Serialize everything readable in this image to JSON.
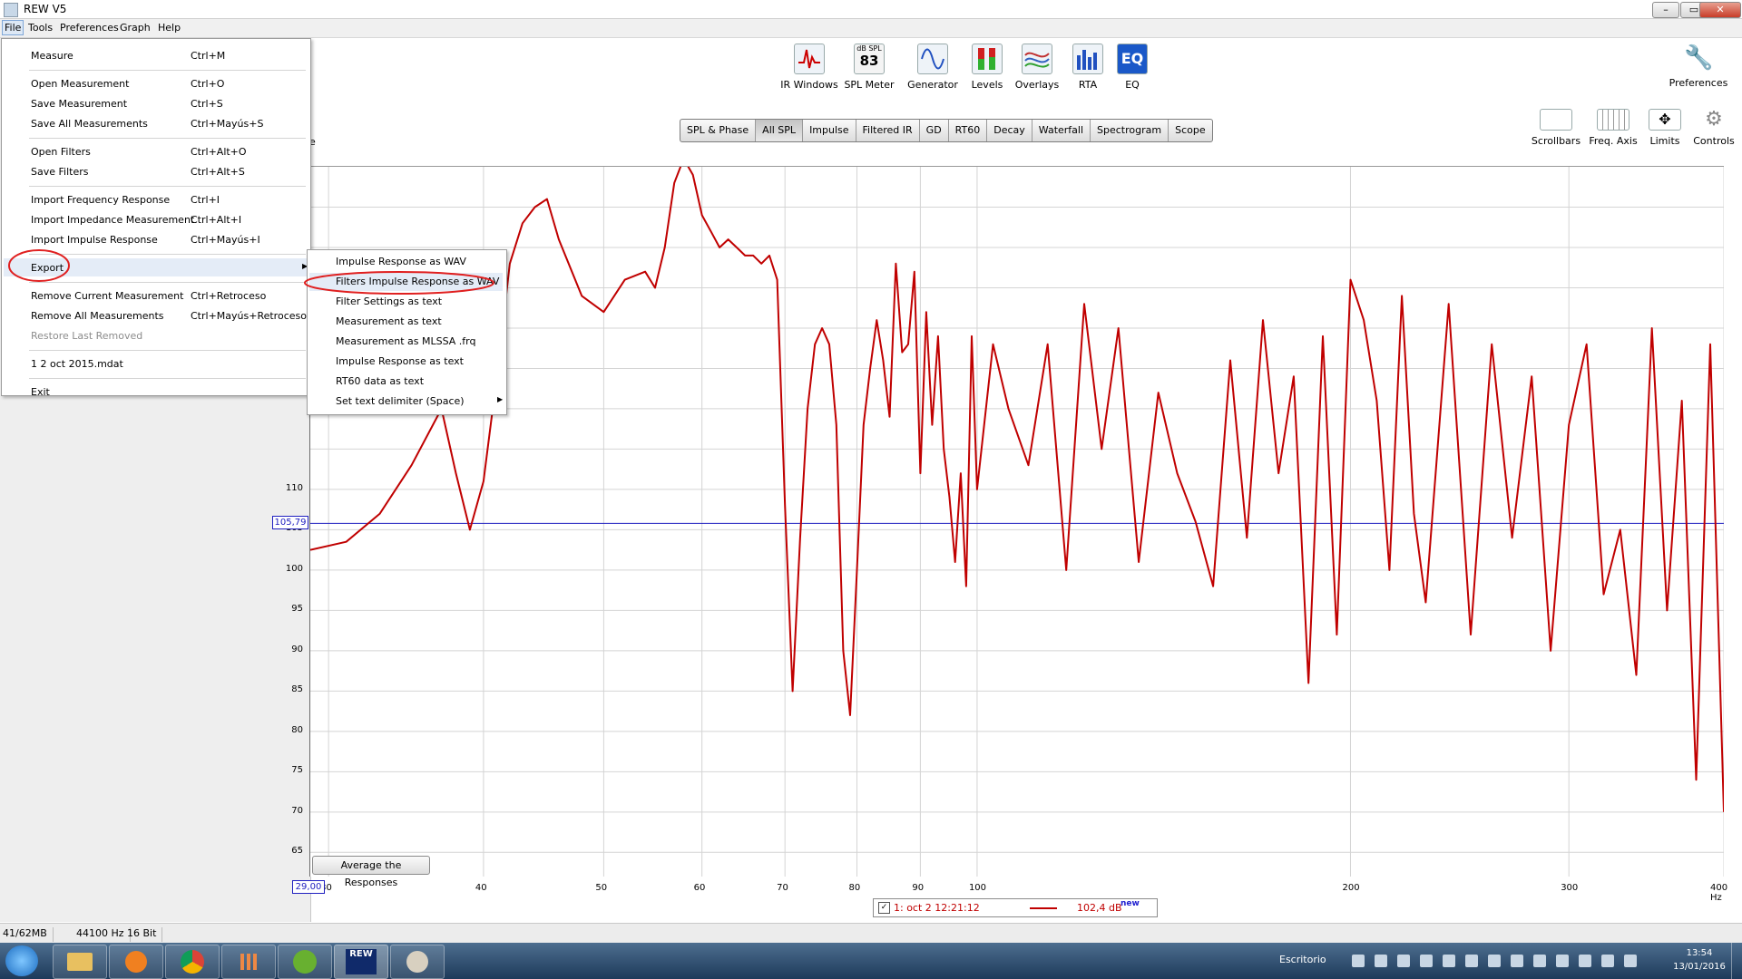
{
  "window": {
    "title": "REW V5",
    "controls": [
      "–",
      "▭",
      "✕"
    ]
  },
  "menubar": {
    "items": [
      "File",
      "Tools",
      "Preferences",
      "Graph",
      "Help"
    ]
  },
  "toolbar": {
    "items": [
      {
        "label": "IR Windows",
        "icon": "ir-windows-icon"
      },
      {
        "label": "SPL Meter",
        "icon": "spl-meter-icon",
        "top": "dB SPL",
        "value": "83"
      },
      {
        "label": "Generator",
        "icon": "generator-icon"
      },
      {
        "label": "Levels",
        "icon": "levels-icon"
      },
      {
        "label": "Overlays",
        "icon": "overlays-icon"
      },
      {
        "label": "RTA",
        "icon": "rta-icon"
      },
      {
        "label": "EQ",
        "icon": "eq-icon"
      }
    ],
    "preferences": "Preferences",
    "right_controls": [
      "Scrollbars",
      "Freq. Axis",
      "Limits",
      "Controls"
    ]
  },
  "tabs": [
    "SPL & Phase",
    "All SPL",
    "Impulse",
    "Filtered IR",
    "GD",
    "RT60",
    "Decay",
    "Waterfall",
    "Spectrogram",
    "Scope"
  ],
  "selected_tab": "All SPL",
  "file_menu": {
    "items": [
      {
        "label": "Measure",
        "shortcut": "Ctrl+M"
      },
      {
        "label": "Open Measurement",
        "shortcut": "Ctrl+O"
      },
      {
        "label": "Save Measurement",
        "shortcut": "Ctrl+S"
      },
      {
        "label": "Save All Measurements",
        "shortcut": "Ctrl+Mayús+S"
      },
      {
        "label": "Open Filters",
        "shortcut": "Ctrl+Alt+O"
      },
      {
        "label": "Save Filters",
        "shortcut": "Ctrl+Alt+S"
      },
      {
        "label": "Import Frequency Response",
        "shortcut": "Ctrl+I"
      },
      {
        "label": "Import Impedance Measurement",
        "shortcut": "Ctrl+Alt+I"
      },
      {
        "label": "Import Impulse Response",
        "shortcut": "Ctrl+Mayús+I"
      },
      {
        "label": "Export",
        "shortcut": ""
      },
      {
        "label": "Remove Current Measurement",
        "shortcut": "Ctrl+Retroceso"
      },
      {
        "label": "Remove All Measurements",
        "shortcut": "Ctrl+Mayús+Retroceso"
      },
      {
        "label": "Restore Last Removed",
        "shortcut": "",
        "disabled": true
      },
      {
        "label": "1 2 oct 2015.mdat",
        "shortcut": ""
      },
      {
        "label": "Exit",
        "shortcut": ""
      }
    ]
  },
  "export_submenu": {
    "items": [
      "Impulse Response as WAV",
      "Filters Impulse Response as WAV",
      "Filter Settings as text",
      "Measurement as text",
      "Measurement as MLSSA .frq",
      "Impulse Response as text",
      "RT60 data as text",
      "Set text delimiter (Space)"
    ]
  },
  "graph": {
    "cursor_y_value": "105,79",
    "cursor_x_value": "29,00",
    "average_button": "Average the Responses",
    "partial_label": "e",
    "legend": {
      "name": "1: oct 2 12:21:12",
      "value": "102,4 dB",
      "badge": "new",
      "color": "#c00000"
    }
  },
  "chart_data": {
    "type": "line",
    "xscale": "log",
    "xlim": [
      29,
      400
    ],
    "ylim": [
      62,
      150
    ],
    "y_ticks": [
      110,
      105,
      100,
      95,
      90,
      85,
      80,
      75,
      70,
      65
    ],
    "x_ticks": [
      {
        "v": 30,
        "label": "30"
      },
      {
        "v": 40,
        "label": "40"
      },
      {
        "v": 50,
        "label": "50"
      },
      {
        "v": 60,
        "label": "60"
      },
      {
        "v": 70,
        "label": "70"
      },
      {
        "v": 80,
        "label": "80"
      },
      {
        "v": 90,
        "label": "90"
      },
      {
        "v": 100,
        "label": "100"
      },
      {
        "v": 200,
        "label": "200"
      },
      {
        "v": 300,
        "label": "300"
      },
      {
        "v": 400,
        "label": "400 Hz"
      }
    ],
    "grid": true,
    "cursor_line": 105.79,
    "series": [
      {
        "color": "#c00000",
        "x": [
          29,
          31,
          33,
          35,
          37,
          38,
          39,
          40,
          41,
          42,
          43,
          44,
          45,
          46,
          48,
          50,
          52,
          54,
          55,
          56,
          57,
          58,
          59,
          60,
          61,
          62,
          63,
          64,
          65,
          66,
          67,
          68,
          69,
          70,
          71,
          72,
          73,
          74,
          75,
          76,
          77,
          78,
          79,
          80,
          81,
          82,
          83,
          84,
          85,
          86,
          87,
          88,
          89,
          90,
          91,
          92,
          93,
          94,
          95,
          96,
          97,
          98,
          99,
          100,
          103,
          106,
          110,
          114,
          118,
          122,
          126,
          130,
          135,
          140,
          145,
          150,
          155,
          160,
          165,
          170,
          175,
          180,
          185,
          190,
          195,
          200,
          205,
          210,
          215,
          220,
          225,
          230,
          240,
          250,
          260,
          270,
          280,
          290,
          300,
          310,
          320,
          330,
          340,
          350,
          360,
          370,
          380,
          390,
          400
        ],
        "y": [
          102.5,
          103.5,
          107,
          113,
          120,
          112,
          105,
          111,
          124,
          138,
          143,
          145,
          146,
          141,
          134,
          132,
          136,
          137,
          135,
          140,
          148,
          151,
          149,
          144,
          142,
          140,
          141,
          140,
          139,
          139,
          138,
          139,
          136,
          108,
          85,
          104,
          120,
          128,
          130,
          128,
          118,
          90,
          82,
          100,
          118,
          125,
          131,
          126,
          119,
          138,
          127,
          128,
          137,
          112,
          132,
          118,
          129,
          115,
          109,
          101,
          112,
          98,
          129,
          110,
          128,
          120,
          113,
          128,
          100,
          133,
          115,
          130,
          101,
          122,
          112,
          106,
          98,
          126,
          104,
          131,
          112,
          124,
          86,
          129,
          92,
          136,
          131,
          121,
          100,
          134,
          107,
          96,
          133,
          92,
          128,
          104,
          124,
          90,
          118,
          128,
          97,
          105,
          87,
          130,
          95,
          121,
          74,
          128,
          70
        ]
      }
    ]
  },
  "statusbar": {
    "memory": "41/62MB",
    "sample_rate": "44100 Hz",
    "bits": "16 Bit"
  },
  "taskbar": {
    "desktop_label": "Escritorio",
    "time": "13:54",
    "date": "13/01/2016",
    "apps": [
      "start-orb-icon",
      "explorer-icon",
      "media-player-icon",
      "chrome-icon",
      "apps-grid-icon",
      "utorrent-icon",
      "rew-icon",
      "paint-icon"
    ]
  }
}
